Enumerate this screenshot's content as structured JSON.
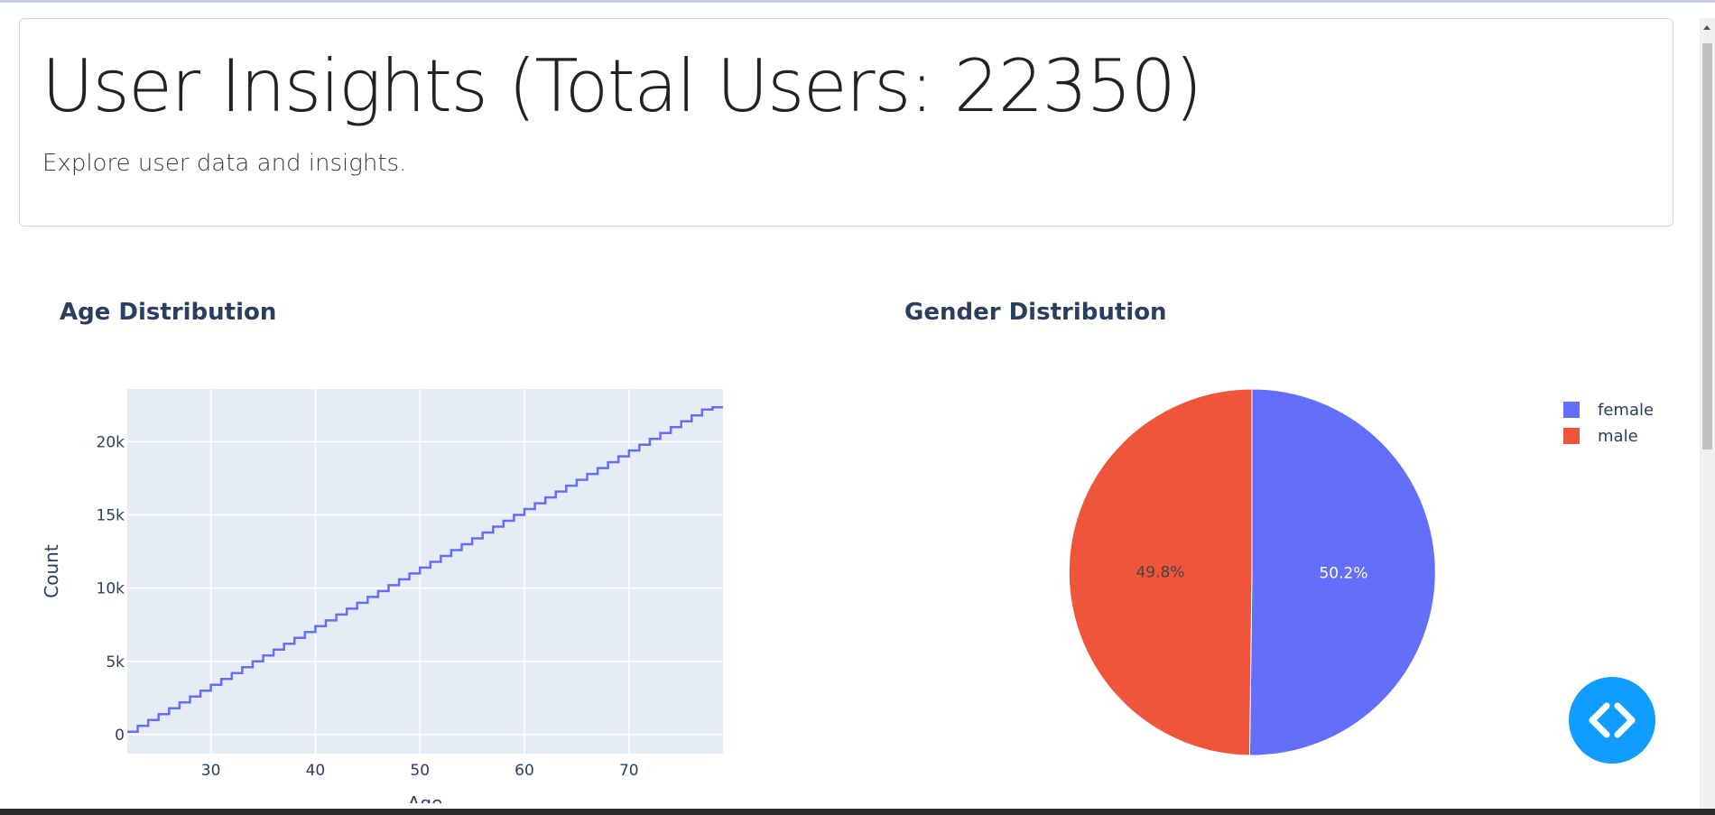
{
  "header": {
    "title": "User Insights (Total Users: 22350)",
    "subtitle": "Explore user data and insights."
  },
  "age_chart": {
    "title": "Age Distribution",
    "xlabel": "Age",
    "ylabel": "Count"
  },
  "gender_chart": {
    "title": "Gender Distribution"
  },
  "colors": {
    "plot_bg": "#e5ecf6",
    "line": "#636efa",
    "female": "#636efa",
    "male": "#ef553b",
    "axis_text": "#2a3f5f",
    "fab": "#119dff"
  },
  "icons": {
    "fab": "code-brackets-icon"
  },
  "chart_data": [
    {
      "type": "line",
      "title": "Age Distribution",
      "xlabel": "Age",
      "ylabel": "Count",
      "xlim": [
        22,
        79
      ],
      "ylim": [
        -1300,
        23600
      ],
      "x_ticks": [
        30,
        40,
        50,
        60,
        70
      ],
      "x_tick_labels": [
        "30",
        "40",
        "50",
        "60",
        "70"
      ],
      "y_ticks": [
        0,
        5000,
        10000,
        15000,
        20000
      ],
      "y_tick_labels": [
        "0",
        "5k",
        "10k",
        "15k",
        "20k"
      ],
      "grid": true,
      "line_shape": "step",
      "series": [
        {
          "x": [
            22,
            23,
            24,
            25,
            26,
            27,
            28,
            29,
            30,
            31,
            32,
            33,
            34,
            35,
            36,
            37,
            38,
            39,
            40,
            41,
            42,
            43,
            44,
            45,
            46,
            47,
            48,
            49,
            50,
            51,
            52,
            53,
            54,
            55,
            56,
            57,
            58,
            59,
            60,
            61,
            62,
            63,
            64,
            65,
            66,
            67,
            68,
            69,
            70,
            71,
            72,
            73,
            74,
            75,
            76,
            77,
            78,
            79
          ],
          "y": [
            200,
            600,
            1000,
            1400,
            1800,
            2200,
            2600,
            3000,
            3400,
            3800,
            4200,
            4600,
            5000,
            5400,
            5800,
            6200,
            6600,
            7000,
            7400,
            7800,
            8200,
            8600,
            9000,
            9400,
            9800,
            10200,
            10600,
            11000,
            11400,
            11800,
            12200,
            12600,
            13000,
            13400,
            13800,
            14200,
            14600,
            15000,
            15400,
            15800,
            16200,
            16600,
            17000,
            17400,
            17800,
            18200,
            18600,
            19000,
            19400,
            19800,
            20200,
            20600,
            21000,
            21400,
            21800,
            22200,
            22350,
            22350
          ]
        }
      ]
    },
    {
      "type": "pie",
      "title": "Gender Distribution",
      "legend": "top-right",
      "slices": [
        {
          "label": "female",
          "value": 50.2,
          "text": "50.2%",
          "color": "#636efa"
        },
        {
          "label": "male",
          "value": 49.8,
          "text": "49.8%",
          "color": "#ef553b"
        }
      ]
    }
  ]
}
